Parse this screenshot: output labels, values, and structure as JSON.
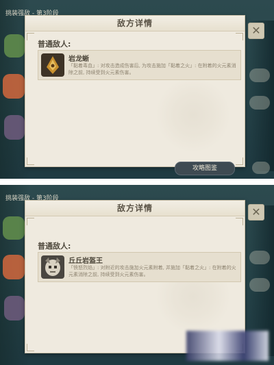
{
  "screens": [
    {
      "background_label": "挑装强敌 - 第3阶段",
      "panel_title": "敌方详情",
      "section_title": "普通敌人:",
      "enemy": {
        "name": "岩龙蜥",
        "description": "「黏着毒血」: 对攻击造成伤害后, 为攻击施加「黏着之火」: 在附着的火元素消除之前, 持续受到火元素伤害。",
        "portrait_icon": "rock-lizard-portrait-icon"
      },
      "tutorial_button_label": "攻略图鉴",
      "close_icon": "close-icon"
    },
    {
      "background_label": "挑装强敌 - 第3阶段",
      "panel_title": "敌方详情",
      "section_title": "普通敌人:",
      "enemy": {
        "name": "丘丘岩盔王",
        "description": "「愤怒烈焰」: 对附近的攻击施加火元素附着, 并施加「黏着之火」: 在附着的火元素消除之前, 持续受到火元素伤害。",
        "portrait_icon": "hilichurl-king-portrait-icon"
      },
      "close_icon": "close-icon"
    }
  ],
  "colors": {
    "panel_bg": "#efeadf",
    "panel_border": "#c8bea7",
    "text_dark": "#4f493d",
    "text_muted": "#8d8370",
    "game_bg": "#2d4a4f"
  }
}
